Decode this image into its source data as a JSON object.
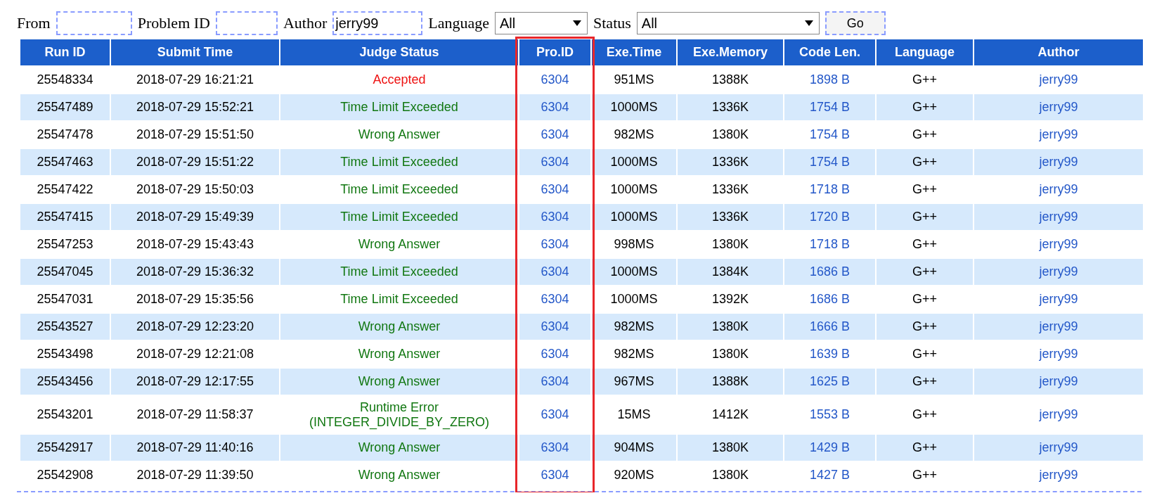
{
  "filters": {
    "from": {
      "label": "From"
    },
    "problem_id": {
      "label": "Problem ID"
    },
    "author": {
      "label": "Author",
      "value": "jerry99"
    },
    "language": {
      "label": "Language",
      "value": "All"
    },
    "status": {
      "label": "Status",
      "value": "All"
    },
    "go_button": "Go"
  },
  "table": {
    "columns": [
      {
        "label": "Run ID",
        "kind": "plain"
      },
      {
        "label": "Submit Time",
        "kind": "plain"
      },
      {
        "label": "Judge Status",
        "kind": "plain"
      },
      {
        "label": "Pro.ID",
        "kind": "framed"
      },
      {
        "label": "Exe.Time",
        "kind": "plain"
      },
      {
        "label": "Exe.Memory",
        "kind": "plain"
      },
      {
        "label": "Code Len.",
        "kind": "plain"
      },
      {
        "label": "Language",
        "kind": "plain"
      },
      {
        "label": "Author",
        "kind": "plain"
      }
    ],
    "rows": [
      {
        "run_id": "25548334",
        "submit_time": "2018-07-29 16:21:21",
        "status": {
          "kind": "accepted",
          "lines": [
            "Accepted"
          ]
        },
        "problem_id": "6304",
        "exe_time": "951MS",
        "exe_memory": "1388K",
        "code_length": "1898 B",
        "language": "G++",
        "author": "jerry99"
      },
      {
        "run_id": "25547489",
        "submit_time": "2018-07-29 15:52:21",
        "status": {
          "kind": "rejected",
          "lines": [
            "Time Limit Exceeded"
          ]
        },
        "problem_id": "6304",
        "exe_time": "1000MS",
        "exe_memory": "1336K",
        "code_length": "1754 B",
        "language": "G++",
        "author": "jerry99"
      },
      {
        "run_id": "25547478",
        "submit_time": "2018-07-29 15:51:50",
        "status": {
          "kind": "rejected",
          "lines": [
            "Wrong Answer"
          ]
        },
        "problem_id": "6304",
        "exe_time": "982MS",
        "exe_memory": "1380K",
        "code_length": "1754 B",
        "language": "G++",
        "author": "jerry99"
      },
      {
        "run_id": "25547463",
        "submit_time": "2018-07-29 15:51:22",
        "status": {
          "kind": "rejected",
          "lines": [
            "Time Limit Exceeded"
          ]
        },
        "problem_id": "6304",
        "exe_time": "1000MS",
        "exe_memory": "1336K",
        "code_length": "1754 B",
        "language": "G++",
        "author": "jerry99"
      },
      {
        "run_id": "25547422",
        "submit_time": "2018-07-29 15:50:03",
        "status": {
          "kind": "rejected",
          "lines": [
            "Time Limit Exceeded"
          ]
        },
        "problem_id": "6304",
        "exe_time": "1000MS",
        "exe_memory": "1336K",
        "code_length": "1718 B",
        "language": "G++",
        "author": "jerry99"
      },
      {
        "run_id": "25547415",
        "submit_time": "2018-07-29 15:49:39",
        "status": {
          "kind": "rejected",
          "lines": [
            "Time Limit Exceeded"
          ]
        },
        "problem_id": "6304",
        "exe_time": "1000MS",
        "exe_memory": "1336K",
        "code_length": "1720 B",
        "language": "G++",
        "author": "jerry99"
      },
      {
        "run_id": "25547253",
        "submit_time": "2018-07-29 15:43:43",
        "status": {
          "kind": "rejected",
          "lines": [
            "Wrong Answer"
          ]
        },
        "problem_id": "6304",
        "exe_time": "998MS",
        "exe_memory": "1380K",
        "code_length": "1718 B",
        "language": "G++",
        "author": "jerry99"
      },
      {
        "run_id": "25547045",
        "submit_time": "2018-07-29 15:36:32",
        "status": {
          "kind": "rejected",
          "lines": [
            "Time Limit Exceeded"
          ]
        },
        "problem_id": "6304",
        "exe_time": "1000MS",
        "exe_memory": "1384K",
        "code_length": "1686 B",
        "language": "G++",
        "author": "jerry99"
      },
      {
        "run_id": "25547031",
        "submit_time": "2018-07-29 15:35:56",
        "status": {
          "kind": "rejected",
          "lines": [
            "Time Limit Exceeded"
          ]
        },
        "problem_id": "6304",
        "exe_time": "1000MS",
        "exe_memory": "1392K",
        "code_length": "1686 B",
        "language": "G++",
        "author": "jerry99"
      },
      {
        "run_id": "25543527",
        "submit_time": "2018-07-29 12:23:20",
        "status": {
          "kind": "rejected",
          "lines": [
            "Wrong Answer"
          ]
        },
        "problem_id": "6304",
        "exe_time": "982MS",
        "exe_memory": "1380K",
        "code_length": "1666 B",
        "language": "G++",
        "author": "jerry99"
      },
      {
        "run_id": "25543498",
        "submit_time": "2018-07-29 12:21:08",
        "status": {
          "kind": "rejected",
          "lines": [
            "Wrong Answer"
          ]
        },
        "problem_id": "6304",
        "exe_time": "982MS",
        "exe_memory": "1380K",
        "code_length": "1639 B",
        "language": "G++",
        "author": "jerry99"
      },
      {
        "run_id": "25543456",
        "submit_time": "2018-07-29 12:17:55",
        "status": {
          "kind": "rejected",
          "lines": [
            "Wrong Answer"
          ]
        },
        "problem_id": "6304",
        "exe_time": "967MS",
        "exe_memory": "1388K",
        "code_length": "1625 B",
        "language": "G++",
        "author": "jerry99"
      },
      {
        "run_id": "25543201",
        "submit_time": "2018-07-29 11:58:37",
        "status": {
          "kind": "rejected",
          "lines": [
            "Runtime Error",
            "(INTEGER_DIVIDE_BY_ZERO)"
          ]
        },
        "problem_id": "6304",
        "exe_time": "15MS",
        "exe_memory": "1412K",
        "code_length": "1553 B",
        "language": "G++",
        "author": "jerry99"
      },
      {
        "run_id": "25542917",
        "submit_time": "2018-07-29 11:40:16",
        "status": {
          "kind": "rejected",
          "lines": [
            "Wrong Answer"
          ]
        },
        "problem_id": "6304",
        "exe_time": "904MS",
        "exe_memory": "1380K",
        "code_length": "1429 B",
        "language": "G++",
        "author": "jerry99"
      },
      {
        "run_id": "25542908",
        "submit_time": "2018-07-29 11:39:50",
        "status": {
          "kind": "rejected",
          "lines": [
            "Wrong Answer"
          ]
        },
        "problem_id": "6304",
        "exe_time": "920MS",
        "exe_memory": "1380K",
        "code_length": "1427 B",
        "language": "G++",
        "author": "jerry99"
      }
    ]
  }
}
